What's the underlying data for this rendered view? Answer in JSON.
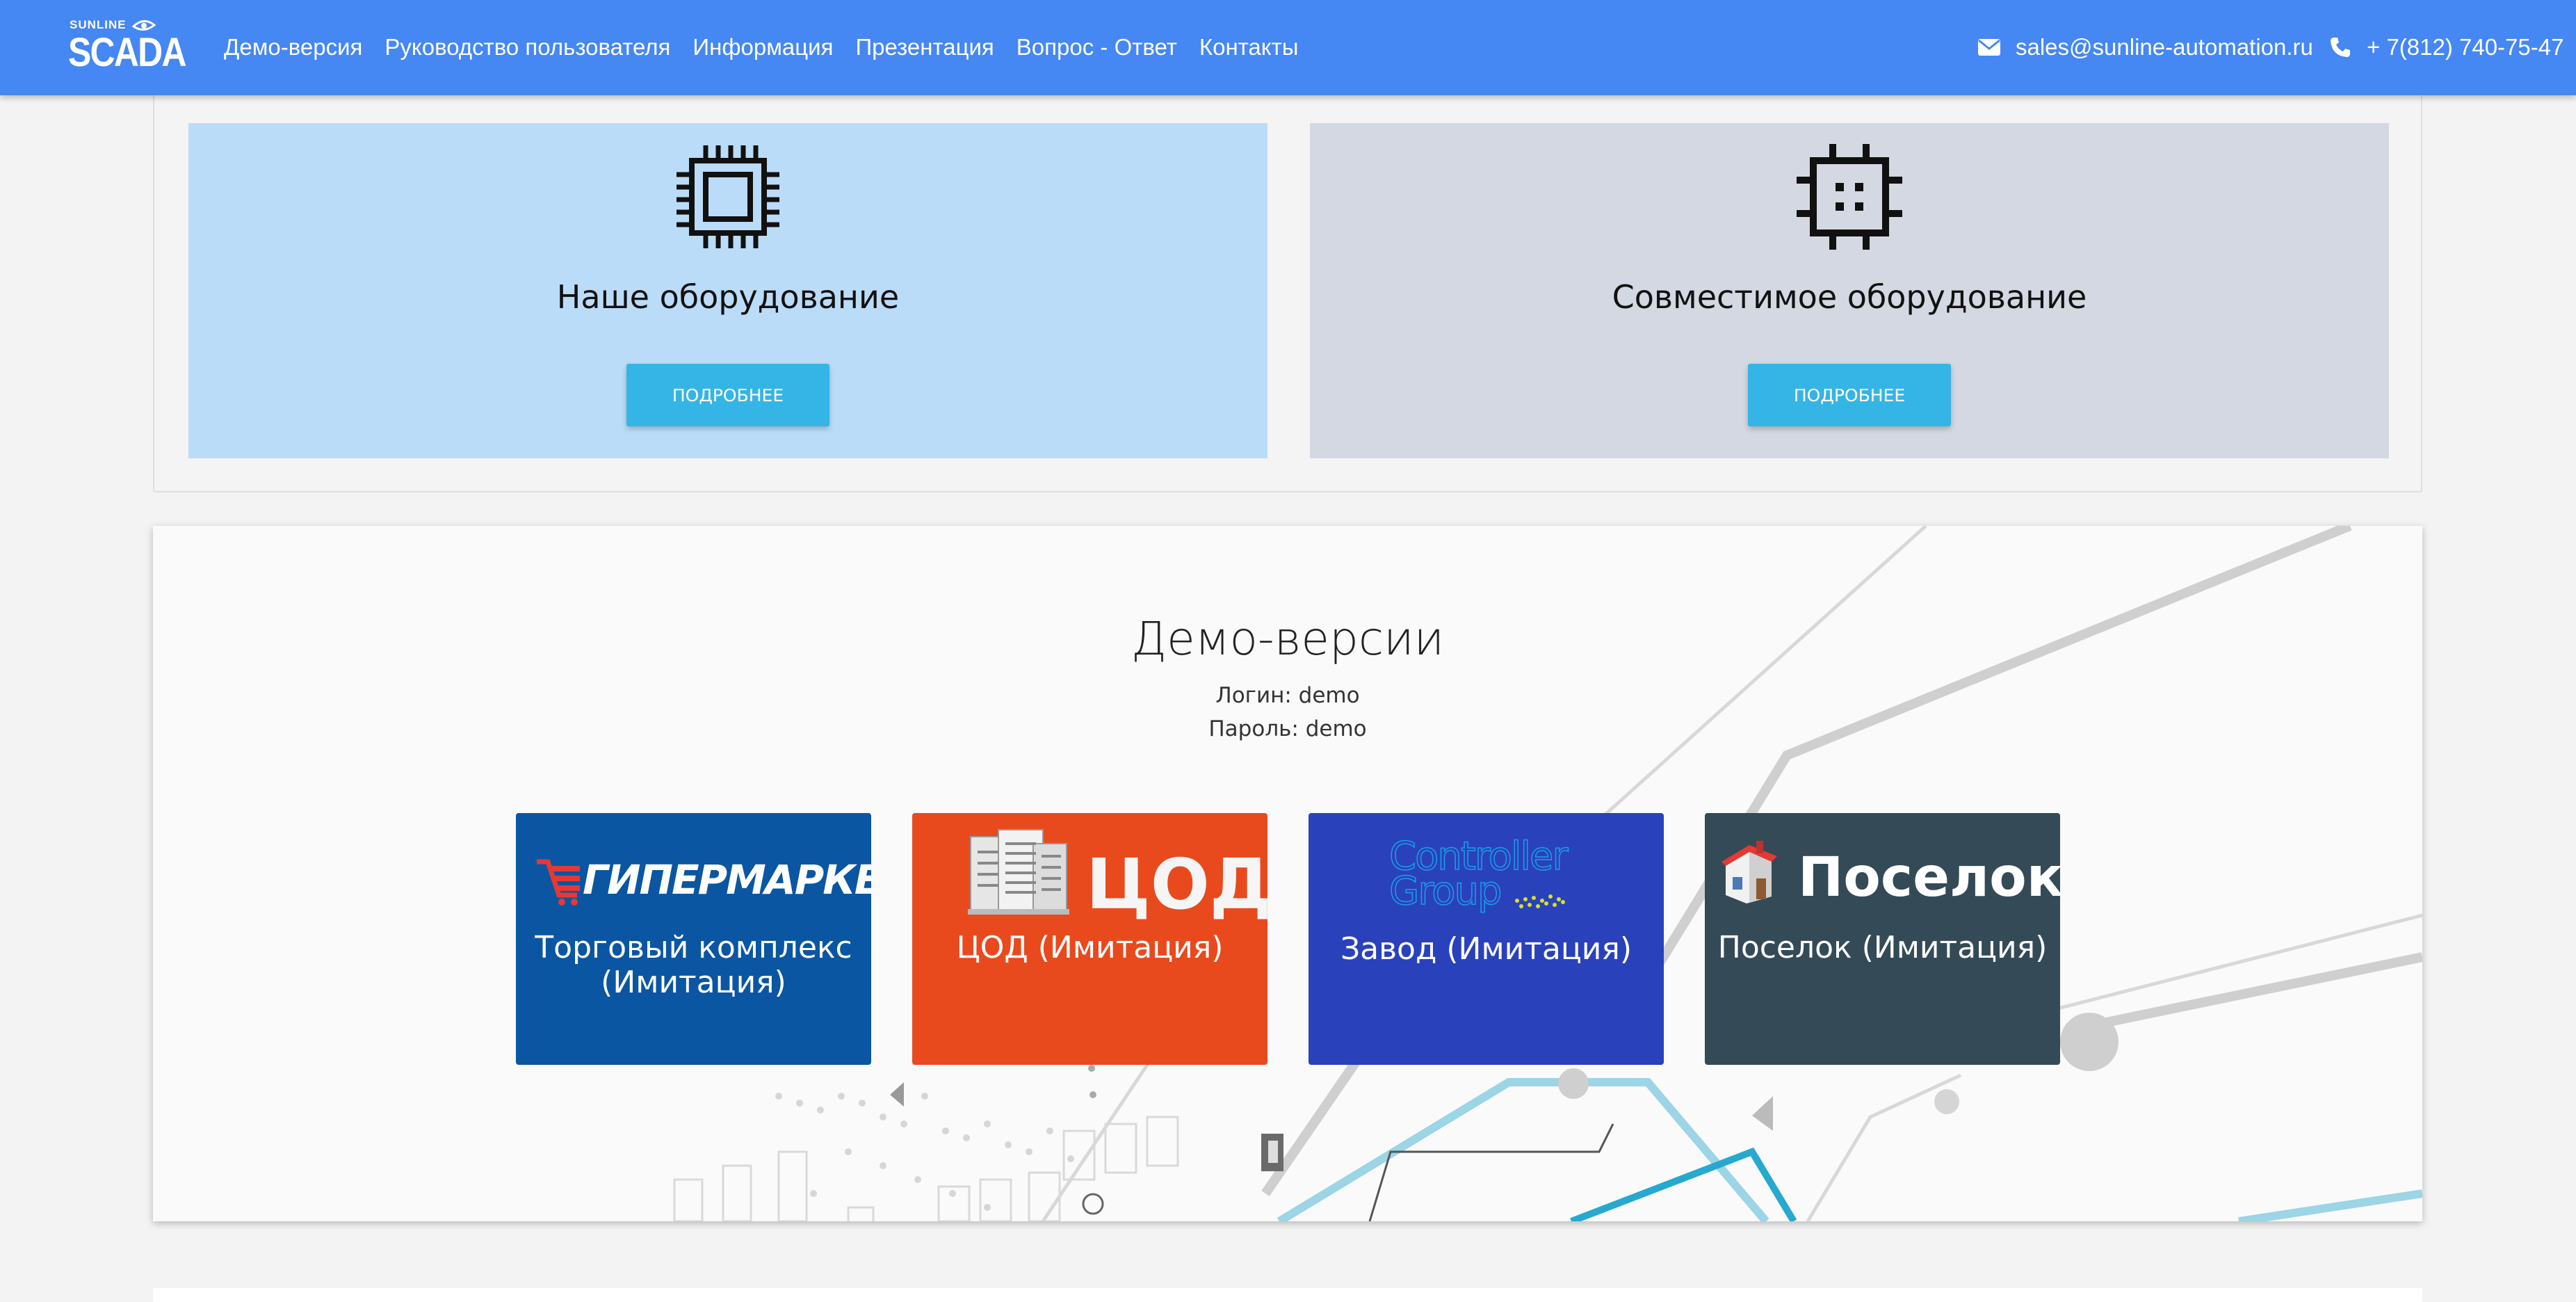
{
  "header": {
    "logo_small": "SUNLINE",
    "logo_main": "SCADA",
    "nav": [
      "Демо-версия",
      "Руководство пользователя",
      "Информация",
      "Презентация",
      "Вопрос - Ответ",
      "Контакты"
    ],
    "email": "sales@sunline-automation.ru",
    "phone": "+ 7(812) 740-75-47",
    "bg_color": "#4587f3"
  },
  "hardware": {
    "ours": {
      "title": "Наше оборудование",
      "button": "ПОДРОБНЕЕ",
      "icon": "chip-icon",
      "bg": "#bbdcf8"
    },
    "compatible": {
      "title": "Совместимое оборудование",
      "button": "ПОДРОБНЕЕ",
      "icon": "board-chip-icon",
      "bg": "#d3d8e2"
    }
  },
  "demo": {
    "title": "Демо-версии",
    "login": "Логин: demo",
    "password": "Пароль: demo",
    "tiles": [
      {
        "logo_text": "ГИПЕРМАРКЕТ",
        "label_line1": "Торговый комплекс",
        "label_line2": "(Имитация)",
        "icon": "shopping-cart-icon",
        "bg": "#0a56a2"
      },
      {
        "logo_text": "ЦОД",
        "label_line1": "ЦОД (Имитация)",
        "icon": "server-rack-icon",
        "bg": "#e84a1e"
      },
      {
        "logo_text_1": "Controller",
        "logo_text_2": "Group",
        "label_line1": "Завод (Имитация)",
        "icon": "controller-group-logo",
        "bg": "#2a41bc"
      },
      {
        "logo_text": "Поселок",
        "label_line1": "Поселок (Имитация)",
        "icon": "house-icon",
        "bg": "#344a57"
      }
    ]
  }
}
